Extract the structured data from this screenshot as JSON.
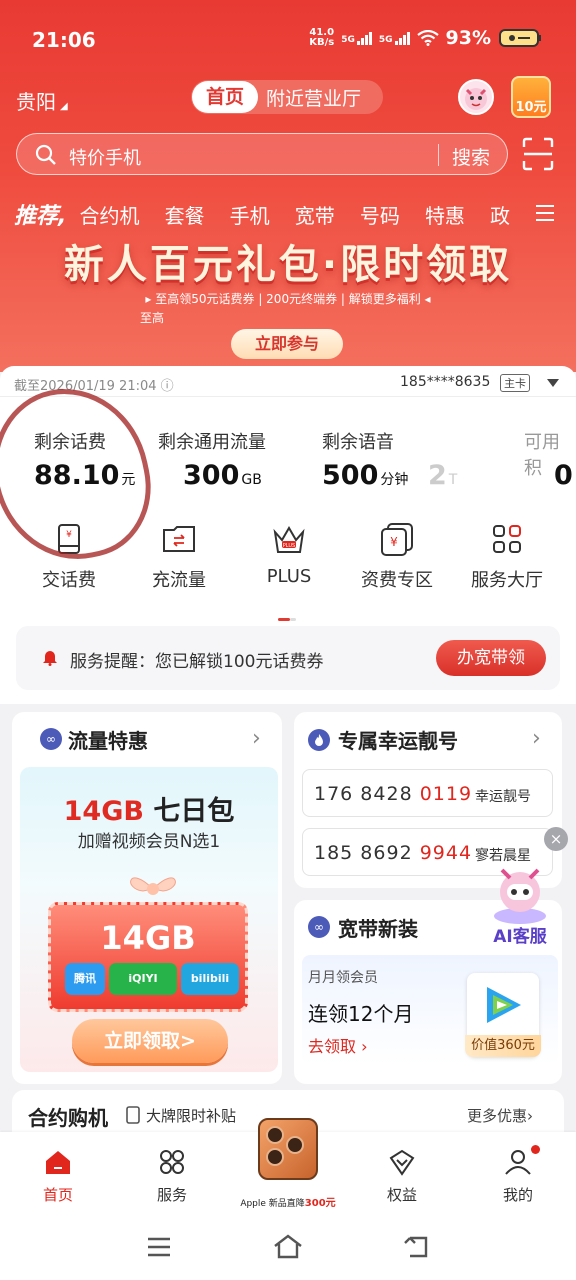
{
  "status": {
    "time": "21:06",
    "speed": "41.0",
    "speed_unit": "KB/s",
    "sim1": "5G",
    "sim2": "5G",
    "battery": "93%"
  },
  "header": {
    "city": "贵阳",
    "tab_home": "首页",
    "tab_nearby": "附近营业厅",
    "coupon": "10元"
  },
  "search": {
    "placeholder": "特价手机",
    "button": "搜索"
  },
  "categories": {
    "lead": "推荐",
    "items": [
      "合约机",
      "套餐",
      "手机",
      "宽带",
      "号码",
      "特惠",
      "政"
    ]
  },
  "banner": {
    "title": "新人百元礼包·限时领取",
    "subtitle": "▸ 至高领50元话费券 | 200元终端券 | 解锁更多福利 ◂",
    "subtitle2": "至高",
    "button": "立即参与"
  },
  "account": {
    "as_of": "截至2026/01/19 21:04 ⓘ",
    "phone": "185****8635",
    "tag": "主卡",
    "balances": [
      {
        "label": "剩余话费",
        "value": "88.10",
        "unit": "元"
      },
      {
        "label": "剩余通用流量",
        "value": "300",
        "unit": "GB"
      },
      {
        "label": "剩余语音",
        "value": "500",
        "unit": "分钟"
      },
      {
        "label": "",
        "value": "2",
        "unit": "T"
      },
      {
        "label": "可用积",
        "value": "0",
        "unit": ""
      }
    ]
  },
  "quick": [
    {
      "label": "交话费",
      "icon": "payment-icon"
    },
    {
      "label": "充流量",
      "icon": "data-topup-icon"
    },
    {
      "label": "PLUS",
      "icon": "crown-icon"
    },
    {
      "label": "资费专区",
      "icon": "tariff-icon"
    },
    {
      "label": "服务大厅",
      "icon": "grid-icon"
    }
  ],
  "notice": {
    "text": "服务提醒：您已解锁100元话费券",
    "button": "办宽带领"
  },
  "traffic": {
    "title": "流量特惠",
    "headline_num": "14GB",
    "headline_text": "七日包",
    "subline": "加赠视频会员N选1",
    "ticket": "14GB",
    "apps": [
      "腾讯",
      "iQIYI",
      "bilibili"
    ],
    "cta": "立即领取>"
  },
  "lucky": {
    "title": "专属幸运靓号",
    "numbers": [
      {
        "prefix": "176 8428 ",
        "highlight": "0119",
        "tag": "幸运靓号"
      },
      {
        "prefix": "185 8692 ",
        "highlight": "9944",
        "tag": "寥若晨星"
      }
    ]
  },
  "broadband": {
    "title": "宽带新装",
    "line1": "月月领会员",
    "line2": "连领12个月",
    "link": "去领取 ›",
    "value": "价值360元"
  },
  "ai": {
    "label": "AI客服"
  },
  "contract": {
    "title": "合约购机",
    "subtitle": "大牌限时补贴",
    "more": "更多优惠›"
  },
  "tabbar": [
    {
      "label": "首页",
      "icon": "home-icon"
    },
    {
      "label": "服务",
      "icon": "service-icon"
    },
    {
      "label": "Apple 新品直降300元",
      "icon": "phone-promo"
    },
    {
      "label": "权益",
      "icon": "benefit-icon"
    },
    {
      "label": "我的",
      "icon": "profile-icon"
    }
  ],
  "tabbar_promo": {
    "brand": "Apple 新品直降",
    "price": "300元"
  },
  "colors": {
    "brand_red": "#e0261d",
    "hero_red": "#e83a33"
  }
}
